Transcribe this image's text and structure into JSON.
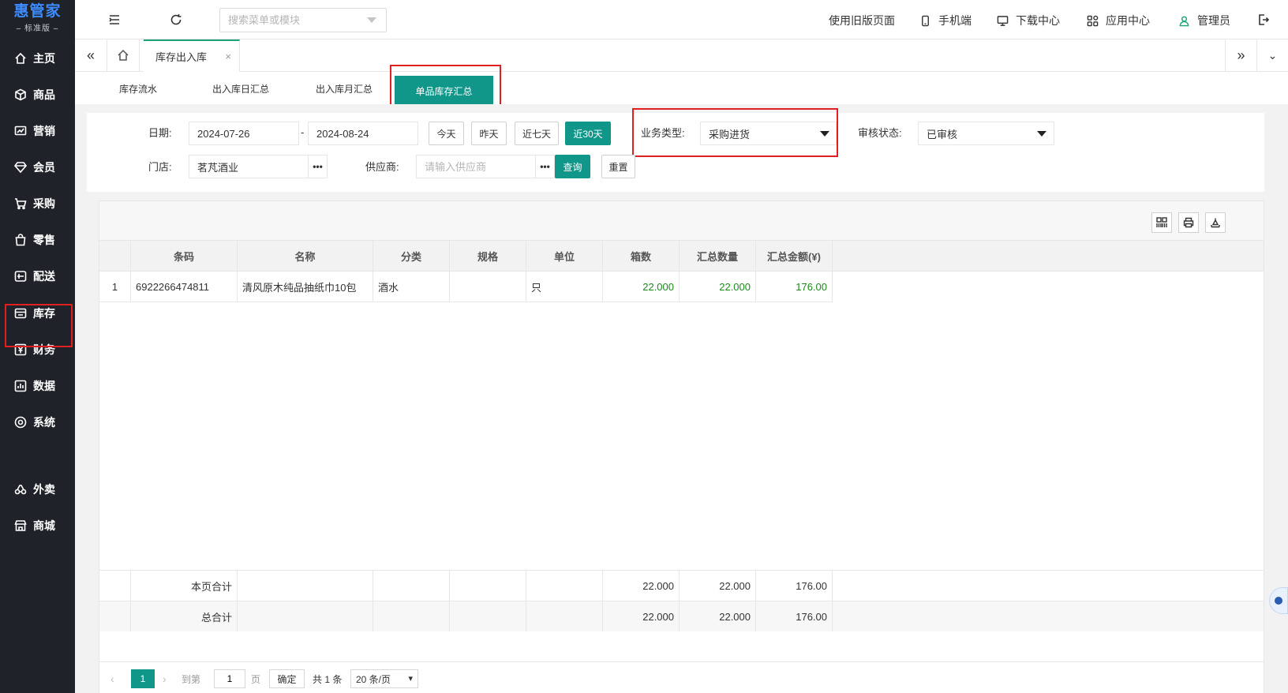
{
  "brand": {
    "name": "惠管家",
    "edition": "标准版"
  },
  "sidebar": {
    "items": [
      {
        "id": "home",
        "label": "主页",
        "icon": "home-icon"
      },
      {
        "id": "goods",
        "label": "商品",
        "icon": "box-icon"
      },
      {
        "id": "marketing",
        "label": "营销",
        "icon": "chart-icon"
      },
      {
        "id": "member",
        "label": "会员",
        "icon": "diamond-icon"
      },
      {
        "id": "purchase",
        "label": "采购",
        "icon": "cart-icon"
      },
      {
        "id": "retail",
        "label": "零售",
        "icon": "bag-icon"
      },
      {
        "id": "delivery",
        "label": "配送",
        "icon": "truck-icon"
      },
      {
        "id": "stock",
        "label": "库存",
        "icon": "inventory-icon",
        "active": true
      },
      {
        "id": "finance",
        "label": "财务",
        "icon": "yen-icon"
      },
      {
        "id": "data",
        "label": "数据",
        "icon": "bar-chart-icon"
      },
      {
        "id": "system",
        "label": "系统",
        "icon": "settings-icon"
      },
      {
        "id": "takeout",
        "label": "外卖",
        "icon": "link-icon"
      },
      {
        "id": "mall",
        "label": "商城",
        "icon": "store-icon"
      }
    ]
  },
  "topbar": {
    "search_placeholder": "搜索菜单或模块",
    "links": {
      "old_version": "使用旧版页面",
      "mobile": "手机端",
      "download": "下载中心",
      "apps": "应用中心",
      "user": "管理员"
    }
  },
  "tabs": {
    "current": "库存出入库"
  },
  "subtabs": {
    "items": [
      "库存流水",
      "出入库日汇总",
      "出入库月汇总"
    ],
    "active": "单品库存汇总"
  },
  "filters": {
    "date_label": "日期:",
    "date_from": "2024-07-26",
    "date_sep": "-",
    "date_to": "2024-08-24",
    "quick": {
      "today": "今天",
      "yesterday": "昨天",
      "week": "近七天",
      "month": "近30天"
    },
    "biz_type_label": "业务类型:",
    "biz_type_value": "采购进货",
    "audit_label": "审核状态:",
    "audit_value": "已审核",
    "store_label": "门店:",
    "store_value": "茗芃酒业",
    "supplier_label": "供应商:",
    "supplier_placeholder": "请输入供应商",
    "dots": "•••",
    "query": "查询",
    "reset": "重置"
  },
  "table": {
    "columns": [
      "条码",
      "名称",
      "分类",
      "规格",
      "单位",
      "箱数",
      "汇总数量",
      "汇总金额(¥)"
    ],
    "rows": [
      {
        "idx": "1",
        "barcode": "6922266474811",
        "name": "清风原木纯品抽纸巾10包",
        "category": "酒水",
        "spec": "",
        "unit": "只",
        "boxes": "22.000",
        "qty": "22.000",
        "amount": "176.00"
      }
    ],
    "page_total": {
      "label": "本页合计",
      "boxes": "22.000",
      "qty": "22.000",
      "amount": "176.00"
    },
    "grand_total": {
      "label": "总合计",
      "boxes": "22.000",
      "qty": "22.000",
      "amount": "176.00"
    }
  },
  "pager": {
    "current": "1",
    "goto_label": "到第",
    "goto_value": "1",
    "page_unit": "页",
    "confirm": "确定",
    "total": "共 1 条",
    "page_size": "20 条/页"
  }
}
